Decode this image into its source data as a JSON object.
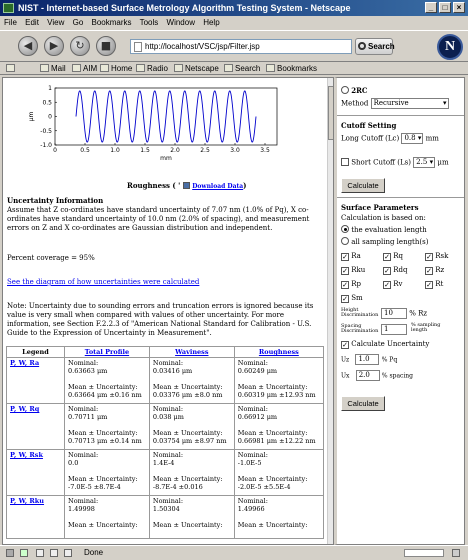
{
  "window": {
    "title": "NIST - Internet-based Surface Metrology Algorithm Testing System - Netscape"
  },
  "menu": [
    "File",
    "Edit",
    "View",
    "Go",
    "Bookmarks",
    "Tools",
    "Window",
    "Help"
  ],
  "nav": {
    "url": "http://localhost/VSC/jsp/Filter.jsp",
    "search_label": "Search"
  },
  "personal_bar": [
    "Mail",
    "AIM",
    "Home",
    "Radio",
    "Netscape",
    "Search",
    "Bookmarks"
  ],
  "chart_data": {
    "type": "line",
    "title": "",
    "xlabel": "mm",
    "ylabel": "μm",
    "xlim": [
      0,
      3.7
    ],
    "ylim": [
      -1,
      1
    ],
    "xticks": [
      "0",
      "0.5",
      "1.0",
      "1.5",
      "2.0",
      "2.5",
      "3.0",
      "3.5"
    ],
    "yticks": [
      "1",
      "0.5",
      "0",
      "-0.5",
      "-1.0"
    ],
    "series": [
      {
        "function": "sine",
        "amplitude": 0.9,
        "wavelength_mm": 0.25,
        "x_start": 0.35,
        "x_end": 3.35
      }
    ],
    "caption": "Roughness",
    "download_label": "Download Data"
  },
  "main": {
    "uncertainty_heading": "Uncertainty Information",
    "para1": "Assume that Z co-ordinates have standard uncertainty of 7.07 nm (1.0% of Pq), X co-ordinates have standard uncertainty of 10.0 nm (2.0% of spacing), and measurement errors on Z and X co-ordinates are Gaussian distribution and independent.",
    "coverage": "Percent coverage = 95%",
    "link": "See the diagram of how uncertainties were calculated",
    "note": "Note: Uncertainty due to sounding errors and truncation errors is ignored because its value is very small when compared with values of other uncertainty. For more information, see Section F.2.2.3 of \"American National Standard for Calibration - U.S. Guide to the Expression of Uncertainty in Measurement\".",
    "table": {
      "headers": [
        "Legend",
        "Total Profile",
        "Waviness",
        "Roughness"
      ],
      "rows": [
        {
          "legend": "P, W, Ra",
          "cells": [
            [
              "Nominal:",
              "0.63663 μm",
              "",
              "Mean ± Uncertainty:",
              "0.63664 μm ±0.16 nm"
            ],
            [
              "Nominal:",
              "0.03416 μm",
              "",
              "Mean ± Uncertainty:",
              "0.03376 μm ±8.0 nm"
            ],
            [
              "Nominal:",
              "0.60249 μm",
              "",
              "Mean ± Uncertainty:",
              "0.60319 μm ±12.93 nm"
            ]
          ]
        },
        {
          "legend": "P, W, Rq",
          "cells": [
            [
              "Nominal:",
              "0.70711 μm",
              "",
              "Mean ± Uncertainty:",
              "0.70713 μm ±0.14 nm"
            ],
            [
              "Nominal:",
              "0.038 μm",
              "",
              "Mean ± Uncertainty:",
              "0.03754 μm ±8.97 nm"
            ],
            [
              "Nominal:",
              "0.66912 μm",
              "",
              "Mean ± Uncertainty:",
              "0.66981 μm ±12.22 nm"
            ]
          ]
        },
        {
          "legend": "P, W, Rsk",
          "cells": [
            [
              "Nominal:",
              "0.0",
              "",
              "Mean ± Uncertainty:",
              "-7.0E-5 ±8.7E-4"
            ],
            [
              "Nominal:",
              "1.4E-4",
              "",
              "Mean ± Uncertainty:",
              "-8.7E-4 ±0.016"
            ],
            [
              "Nominal:",
              "-1.0E-5",
              "",
              "Mean ± Uncertainty:",
              "-2.0E-5 ±5.5E-4"
            ]
          ]
        },
        {
          "legend": "P, W, Rku",
          "cells": [
            [
              "Nominal:",
              "1.49998",
              "",
              "Mean ± Uncertainty:",
              ""
            ],
            [
              "Nominal:",
              "1.50304",
              "",
              "Mean ± Uncertainty:",
              ""
            ],
            [
              "Nominal:",
              "1.49966",
              "",
              "Mean ± Uncertainty:",
              ""
            ]
          ]
        }
      ]
    }
  },
  "side": {
    "filter_2rc": "2RC",
    "method_label": "Method",
    "method_value": "Recursive",
    "cutoff_heading": "Cutoff Setting",
    "long_label": "Long Cutoff (Lc)",
    "long_value": "0.8",
    "mm": "mm",
    "short_label": "Short Cutoff (Ls)",
    "short_value": "2.5",
    "um": "μm",
    "calculate": "Calculate",
    "surface_heading": "Surface Parameters",
    "based_on": "Calculation is based on:",
    "eval_length": "the evaluation length",
    "all_sampling": "all sampling length(s)",
    "params": [
      "Ra",
      "Rq",
      "Rsk",
      "Rku",
      "Rdq",
      "Rz",
      "Rp",
      "Rv",
      "Rt",
      "Sm"
    ],
    "height_label": "Height Discrimination",
    "height_value": "10",
    "height_unit": "% Rz",
    "spacing_label": "Spacing Discrimination",
    "spacing_value": "1",
    "spacing_unit": "% sampling length",
    "calc_uncertainty": "Calculate Uncertainty",
    "uz_label": "Uz",
    "uz_value": "1.0",
    "uz_unit": "% Pq",
    "ux_label": "Ux",
    "ux_value": "2.0",
    "ux_unit": "% spacing"
  },
  "status": {
    "text": "Done"
  }
}
